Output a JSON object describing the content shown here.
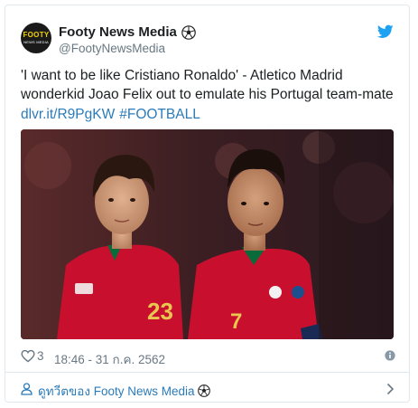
{
  "account": {
    "name": "Footy News Media",
    "handle": "@FootyNewsMedia",
    "avatar_text": "FOOTY",
    "avatar_subtext": "NEWS MEDIA",
    "name_icon": "soccer-ball-icon"
  },
  "tweet": {
    "text": "'I want to be like Cristiano Ronaldo' - Atletico Madrid wonderkid Joao Felix out to emulate his Portugal team-mate",
    "link": "dlvr.it/R9PgKW",
    "hashtag": "#FOOTBALL"
  },
  "media": {
    "jersey_numbers": [
      "23",
      "7"
    ]
  },
  "meta": {
    "likes": "3",
    "timestamp": "18:46 - 31 ก.ค. 2562"
  },
  "footer": {
    "label": "ดูทวีตของ Footy News Media"
  },
  "colors": {
    "link": "#2b7bb9",
    "twitter_blue": "#1da1f2",
    "muted": "#697882",
    "border": "#e1e8ed",
    "jersey_red": "#c8102e"
  },
  "icons": [
    "twitter-bird-icon",
    "heart-icon",
    "info-icon",
    "person-icon",
    "chevron-right-icon",
    "soccer-ball-icon"
  ]
}
